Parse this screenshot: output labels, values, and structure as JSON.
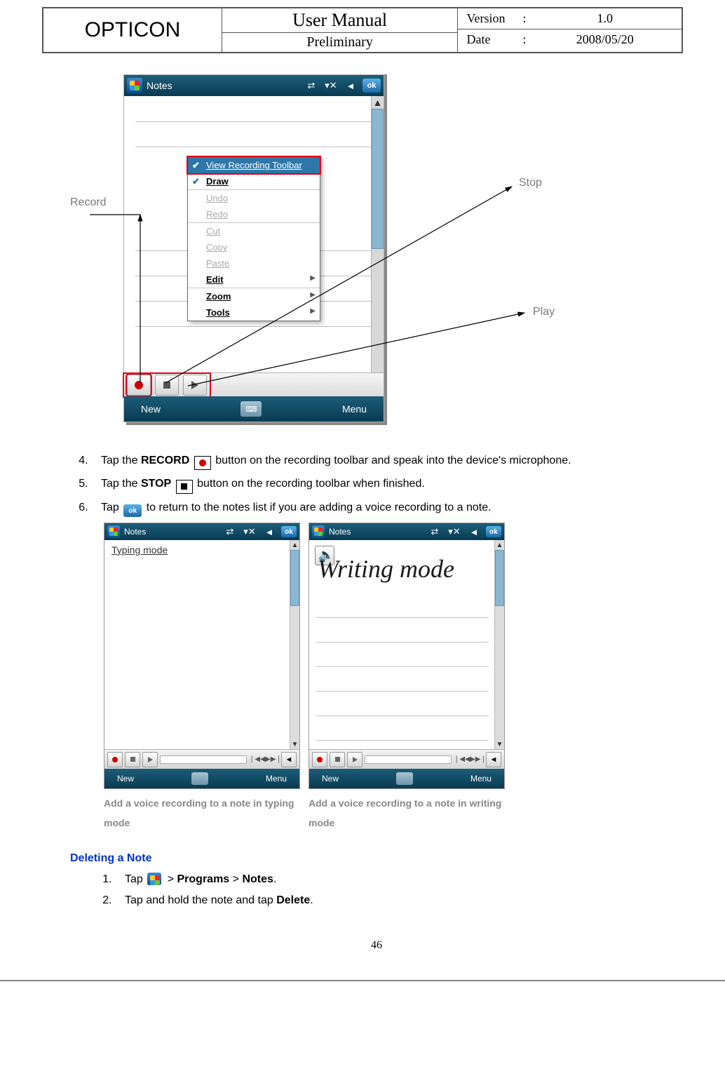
{
  "header": {
    "brand": "OPTICON",
    "title": "User Manual",
    "subtitle": "Preliminary",
    "version_label": "Version",
    "version_value": "1.0",
    "date_label": "Date",
    "date_value": "2008/05/20",
    "colon": ":"
  },
  "fig1": {
    "app_title": "Notes",
    "ok": "ok",
    "menu": {
      "view_recording": "View Recording Toolbar",
      "draw": "Draw",
      "undo": "Undo",
      "redo": "Redo",
      "cut": "Cut",
      "copy": "Copy",
      "paste": "Paste",
      "edit": "Edit",
      "zoom": "Zoom",
      "tools": "Tools"
    },
    "softkeys": {
      "left": "New",
      "right": "Menu"
    },
    "callouts": {
      "record": "Record",
      "stop": "Stop",
      "play": "Play"
    }
  },
  "steps": {
    "s4_a": "Tap the ",
    "s4_bold": "RECORD",
    "s4_b": " button on the recording toolbar and speak into the device's microphone.",
    "s5_a": "Tap the ",
    "s5_bold": "STOP",
    "s5_b": " button on the recording toolbar when finished.",
    "s6_a": "Tap ",
    "s6_b": " to return to the notes list if you are adding a voice recording to a note.",
    "ok": "ok"
  },
  "pair": {
    "app_title": "Notes",
    "ok": "ok",
    "typed_text": "Typing mode",
    "handwriting": "Writing mode",
    "softkeys": {
      "left": "New",
      "right": "Menu"
    },
    "nav_prev": "❘◀◀",
    "nav_next": "▶▶❘",
    "cap_left": "Add a voice recording to a note in typing mode",
    "cap_right": "Add a voice recording to a note in writing mode"
  },
  "delete_section": {
    "title": "Deleting a Note",
    "d1_a": "Tap ",
    "d1_b": " > ",
    "d1_programs": "Programs",
    "d1_c": " > ",
    "d1_notes": "Notes",
    "d1_d": ".",
    "d2_a": "Tap and hold the note and tap ",
    "d2_delete": "Delete",
    "d2_b": "."
  },
  "page_number": "46"
}
